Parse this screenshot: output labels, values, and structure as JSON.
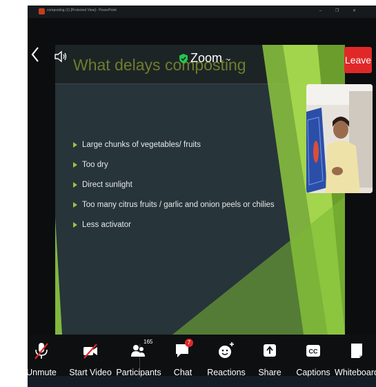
{
  "window": {
    "title": "composting (1) [Protected View] - PowerPoint",
    "controls": "– ❐ ✕"
  },
  "meeting": {
    "app_name": "Zoom",
    "leave_label": "Leave"
  },
  "slide": {
    "title": "What delays composting",
    "bullets": [
      "Large chunks of vegetables/ fruits",
      "Too dry",
      "Direct sunlight",
      "Too many citrus fruits / garlic and onion peels or  chilies",
      "Less activator"
    ]
  },
  "toolbar": {
    "unmute_label": "Unmute",
    "start_video_label": "Start Video",
    "participants_label": "Participants",
    "participants_count": "165",
    "chat_label": "Chat",
    "chat_badge": "7",
    "reactions_label": "Reactions",
    "share_label": "Share",
    "captions_label": "Captions",
    "captions_icon_text": "CC",
    "whiteboard_label": "Whiteboard"
  },
  "colors": {
    "leave": "#e02828",
    "slide_bg": "#27343a",
    "slide_title": "#6f7d2d",
    "bullet_arrow": "#9bc43a",
    "accent_green": "#8cc63f"
  },
  "icons": [
    "back-icon",
    "speaker-icon",
    "shield-check-icon",
    "chevron-down-icon",
    "mic-off-icon",
    "video-off-icon",
    "participants-icon",
    "chat-icon",
    "reactions-icon",
    "share-icon",
    "captions-icon",
    "whiteboard-icon"
  ]
}
